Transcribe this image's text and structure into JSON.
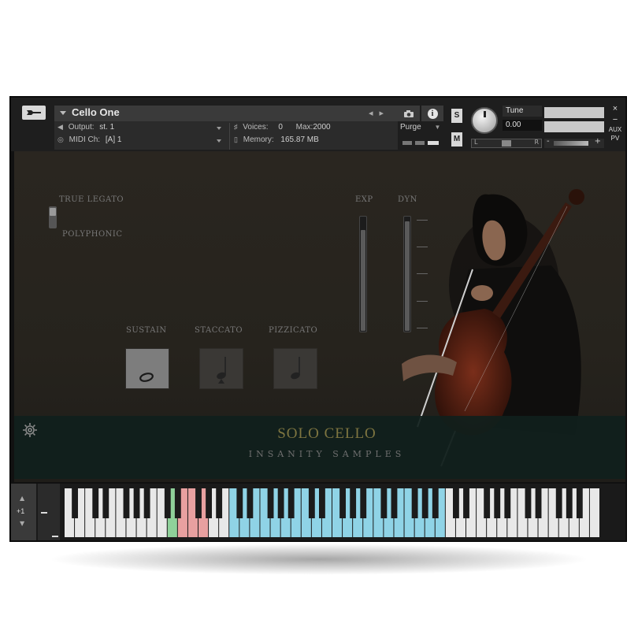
{
  "header": {
    "instrument_name": "Cello One",
    "output_label": "Output:",
    "output_value": "st. 1",
    "voices_label": "Voices:",
    "voices_value": "0",
    "max_label": "Max:",
    "max_value": "2000",
    "midi_label": "MIDI Ch:",
    "midi_value": "[A]  1",
    "memory_label": "Memory:",
    "memory_value": "165.87 MB",
    "purge_label": "Purge",
    "solo_btn": "S",
    "mute_btn": "M",
    "tune_label": "Tune",
    "tune_value": "0.00",
    "pan_left": "L",
    "pan_right": "R",
    "vol_minus": "-",
    "vol_plus": "+",
    "aux_label": "AUX",
    "pv_label": "PV",
    "close_btn": "×",
    "minimize_btn": "−"
  },
  "panel": {
    "legato_label": "TRUE LEGATO",
    "poly_label": "POLYPHONIC",
    "exp_label": "EXP",
    "dyn_label": "DYN",
    "exp_level": 0.88,
    "dyn_level": 0.95,
    "articulations": [
      {
        "label": "SUSTAIN",
        "icon": "whole-note-icon",
        "active": true
      },
      {
        "label": "STACCATO",
        "icon": "staccato-note-icon",
        "active": false
      },
      {
        "label": "PIZZICATO",
        "icon": "pizzicato-note-icon",
        "active": false
      }
    ],
    "title": "SOLO CELLO",
    "brand": "INSANITY SAMPLES"
  },
  "keyboard": {
    "octave_label": "+1",
    "white_key_count": 52,
    "green_keys": [
      10
    ],
    "red_keys": [
      11,
      12,
      13
    ],
    "blue_key_range": [
      16,
      36
    ],
    "colors": {
      "green": "#8fd19a",
      "red": "#e8a0a0",
      "blue": "#8fd3e6",
      "white": "#e8e8e8",
      "black": "#1b1b1b"
    }
  }
}
